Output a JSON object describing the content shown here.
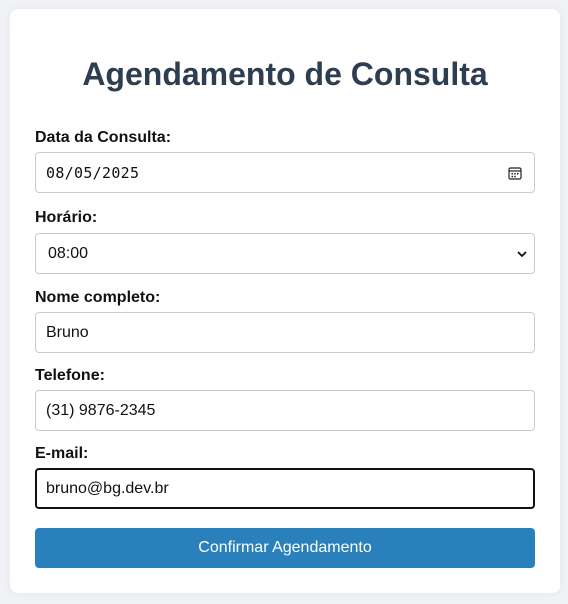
{
  "form": {
    "title": "Agendamento de Consulta",
    "date": {
      "label": "Data da Consulta:",
      "value": "08/05/2025",
      "icon": "calendar-icon"
    },
    "time": {
      "label": "Horário:",
      "selected": "08:00",
      "icon": "chevron-down-icon"
    },
    "name": {
      "label": "Nome completo:",
      "value": "Bruno"
    },
    "phone": {
      "label": "Telefone:",
      "value": "(31) 9876-2345"
    },
    "email": {
      "label": "E-mail:",
      "value": "bruno@bg.dev.br"
    },
    "submit_label": "Confirmar Agendamento"
  },
  "colors": {
    "page_background": "#f0f2f5",
    "card_background": "#ffffff",
    "title": "#2c3e50",
    "button": "#2a80bb",
    "button_text": "#ffffff"
  }
}
